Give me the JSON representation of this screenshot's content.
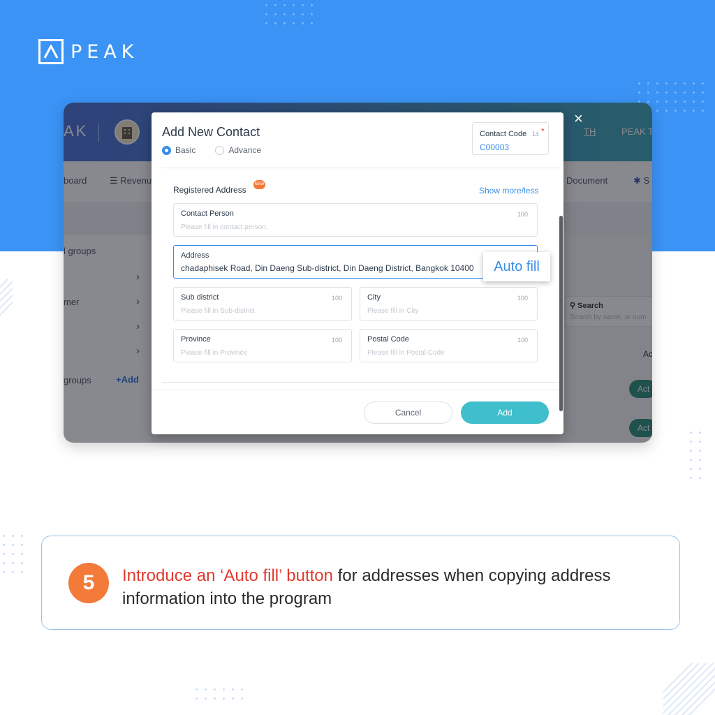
{
  "brand": {
    "logo_text": "PEAK"
  },
  "background_app": {
    "brand_fragment": "AK",
    "nav": {
      "dashboard": "board",
      "revenue": "Revenu",
      "document": "Document",
      "settings": "S"
    },
    "header": {
      "language": "TH",
      "company": "PEAK Te"
    },
    "left_panel": {
      "groups_label": "l groups",
      "customer_label": "mer",
      "groups_label_2": "groups",
      "add_label": "Add"
    },
    "search": {
      "label": "Search",
      "placeholder": "Search by name, or num"
    },
    "table": {
      "column_fragment": "Ac",
      "action_label": "Act"
    }
  },
  "modal": {
    "title": "Add New Contact",
    "close_glyph": "×",
    "tabs": [
      {
        "label": "Basic",
        "selected": true
      },
      {
        "label": "Advance",
        "selected": false
      }
    ],
    "contact_code": {
      "label": "Contact Code",
      "count": "14",
      "required_mark": "*",
      "value": "C00003"
    },
    "section": {
      "title": "Registered Address",
      "badge": "NEW",
      "show_more": "Show more/less"
    },
    "fields": {
      "contact_person": {
        "label": "Contact Person",
        "max": "100",
        "placeholder": "Please fill in contact person."
      },
      "address": {
        "label": "Address",
        "value": "chadaphisek Road, Din Daeng Sub-district, Din Daeng District, Bangkok 10400"
      },
      "sub_district": {
        "label": "Sub district",
        "max": "100",
        "placeholder": "Please fill in Sub-district"
      },
      "city": {
        "label": "City",
        "max": "100",
        "placeholder": "Please fill in City"
      },
      "province": {
        "label": "Province",
        "max": "100",
        "placeholder": "Please fill in Province"
      },
      "postal_code": {
        "label": "Postal Code",
        "max": "100",
        "placeholder": "Please fill in Postal Code"
      }
    },
    "buttons": {
      "cancel": "Cancel",
      "add": "Add"
    }
  },
  "autofill_button": {
    "label": "Auto fill"
  },
  "callout": {
    "step_number": "5",
    "highlight": "Introduce an ‘Auto fill’ button",
    "text": " for addresses when copying address information into the program"
  },
  "colors": {
    "top_band": "#3b93f5",
    "accent_blue": "#3a8de8",
    "add_button": "#3fbfcb",
    "step_badge": "#f47a3a",
    "highlight_red": "#e03a2f"
  },
  "icons": [
    "peak-logo-icon",
    "building-icon",
    "close-icon",
    "revenue-icon",
    "settings-icon",
    "search-icon",
    "chevron-right-icon",
    "plus-icon",
    "radio-icon"
  ]
}
